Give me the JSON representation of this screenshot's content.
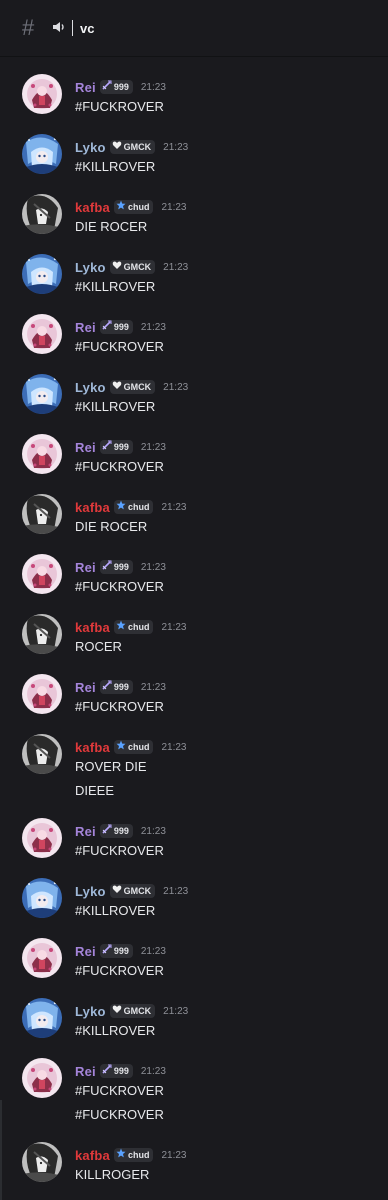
{
  "header": {
    "channel_icon": "hash-icon",
    "voice_icon": "speaker-icon",
    "channel_name": "vc"
  },
  "users": {
    "rei": {
      "name": "Rei",
      "color": "#a484d9",
      "tag": "999",
      "tag_icon": "sword-icon"
    },
    "lyko": {
      "name": "Lyko",
      "color": "#9fb8d8",
      "tag": "GMCK",
      "tag_icon": "heart-icon"
    },
    "kafba": {
      "name": "kafba",
      "color": "#e0393b",
      "tag": "chud",
      "tag_icon": "star-icon"
    }
  },
  "messages": [
    {
      "user": "Rei",
      "time": "21:23",
      "lines": [
        "#FUCKROVER"
      ]
    },
    {
      "user": "Lyko",
      "time": "21:23",
      "lines": [
        "#KILLROVER"
      ]
    },
    {
      "user": "kafba",
      "time": "21:23",
      "lines": [
        "DIE ROCER"
      ]
    },
    {
      "user": "Lyko",
      "time": "21:23",
      "lines": [
        "#KILLROVER"
      ]
    },
    {
      "user": "Rei",
      "time": "21:23",
      "lines": [
        "#FUCKROVER"
      ]
    },
    {
      "user": "Lyko",
      "time": "21:23",
      "lines": [
        "#KILLROVER"
      ]
    },
    {
      "user": "Rei",
      "time": "21:23",
      "lines": [
        "#FUCKROVER"
      ]
    },
    {
      "user": "kafba",
      "time": "21:23",
      "lines": [
        "DIE ROCER"
      ]
    },
    {
      "user": "Rei",
      "time": "21:23",
      "lines": [
        "#FUCKROVER"
      ]
    },
    {
      "user": "kafba",
      "time": "21:23",
      "lines": [
        "ROCER"
      ]
    },
    {
      "user": "Rei",
      "time": "21:23",
      "lines": [
        "#FUCKROVER"
      ]
    },
    {
      "user": "kafba",
      "time": "21:23",
      "lines": [
        "ROVER DIE",
        "DIEEE"
      ]
    },
    {
      "user": "Rei",
      "time": "21:23",
      "lines": [
        "#FUCKROVER"
      ]
    },
    {
      "user": "Lyko",
      "time": "21:23",
      "lines": [
        "#KILLROVER"
      ]
    },
    {
      "user": "Rei",
      "time": "21:23",
      "lines": [
        "#FUCKROVER"
      ]
    },
    {
      "user": "Lyko",
      "time": "21:23",
      "lines": [
        "#KILLROVER"
      ]
    },
    {
      "user": "Rei",
      "time": "21:23",
      "lines": [
        "#FUCKROVER",
        "#FUCKROVER"
      ]
    },
    {
      "user": "kafba",
      "time": "21:23",
      "lines": [
        "KILLROGER"
      ]
    }
  ]
}
